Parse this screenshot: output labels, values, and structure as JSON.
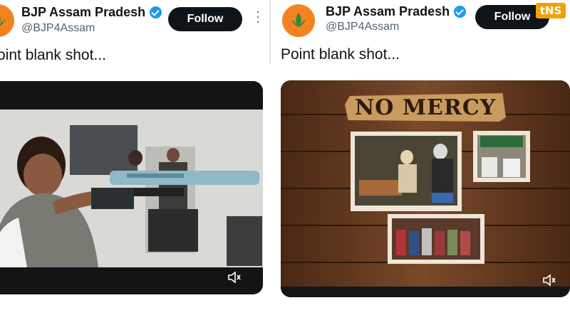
{
  "left_tweet": {
    "account_name": "BJP Assam Pradesh",
    "handle": "@BJP4Assam",
    "follow_label": "Follow",
    "text": "Point blank shot..."
  },
  "right_tweet": {
    "account_name": "BJP Assam Pradesh",
    "handle": "@BJP4Assam",
    "follow_label": "Follow",
    "text": "Point blank shot...",
    "video_title": "NO MERCY"
  },
  "watermark": "tNS",
  "colors": {
    "follow_bg": "#0f1419",
    "verified": "#1d9bf0",
    "bjp_saffron": "#f58220",
    "wood": "#6b3f22"
  }
}
